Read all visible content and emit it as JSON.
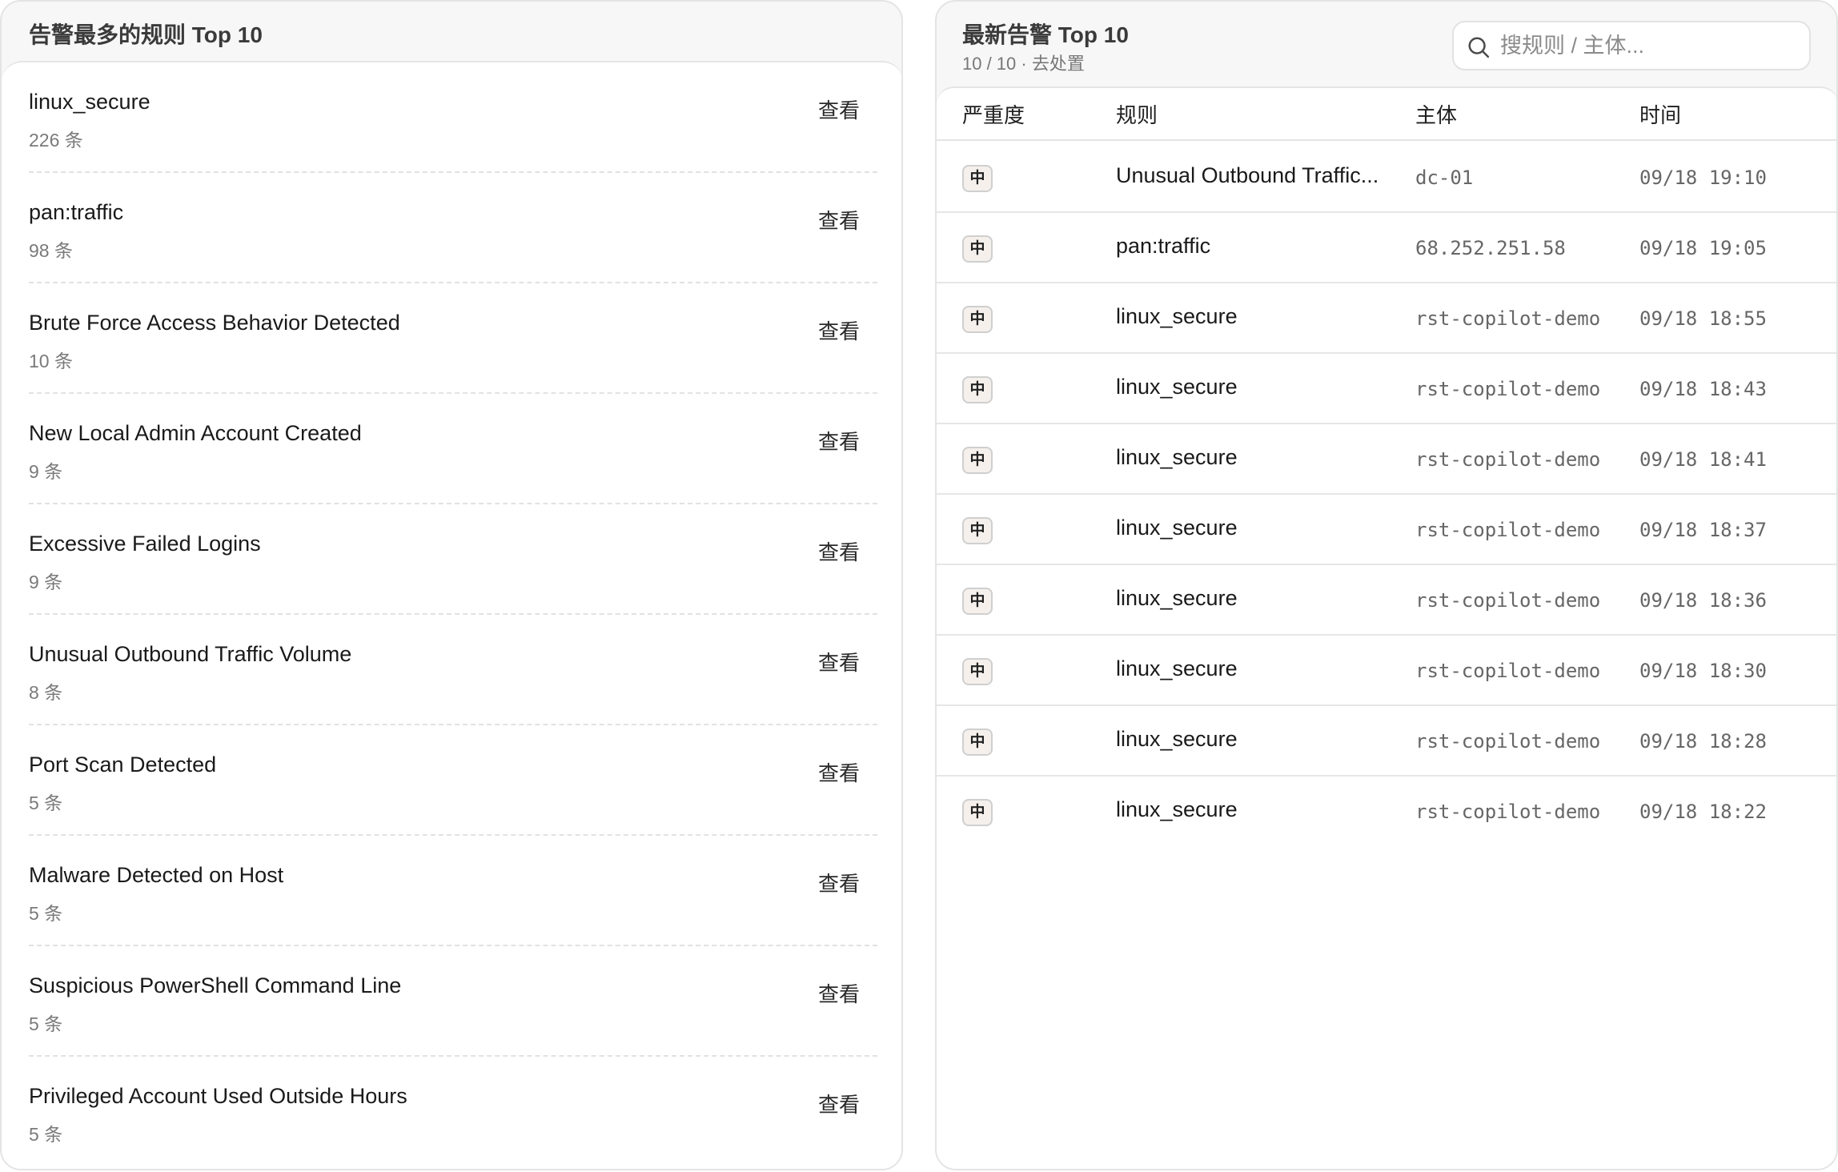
{
  "left": {
    "title": "告警最多的规则 Top 10",
    "view_label": "查看",
    "rules": [
      {
        "name": "linux_secure",
        "count": "226 条"
      },
      {
        "name": "pan:traffic",
        "count": "98 条"
      },
      {
        "name": "Brute Force Access Behavior Detected",
        "count": "10 条"
      },
      {
        "name": "New Local Admin Account Created",
        "count": "9 条"
      },
      {
        "name": "Excessive Failed Logins",
        "count": "9 条"
      },
      {
        "name": "Unusual Outbound Traffic Volume",
        "count": "8 条"
      },
      {
        "name": "Port Scan Detected",
        "count": "5 条"
      },
      {
        "name": "Malware Detected on Host",
        "count": "5 条"
      },
      {
        "name": "Suspicious PowerShell Command Line",
        "count": "5 条"
      },
      {
        "name": "Privileged Account Used Outside Hours",
        "count": "5 条"
      }
    ]
  },
  "right": {
    "title": "最新告警 Top 10",
    "subtitle": "10 / 10 · 去处置",
    "search": {
      "placeholder": "搜规则 / 主体...",
      "value": ""
    },
    "columns": {
      "severity": "严重度",
      "rule": "规则",
      "subject": "主体",
      "time": "时间"
    },
    "rows": [
      {
        "severity": "中",
        "rule": "Unusual Outbound Traffic...",
        "subject": "dc-01",
        "time": "09/18 19:10"
      },
      {
        "severity": "中",
        "rule": "pan:traffic",
        "subject": "68.252.251.58",
        "time": "09/18 19:05"
      },
      {
        "severity": "中",
        "rule": "linux_secure",
        "subject": "rst-copilot-demo",
        "time": "09/18 18:55"
      },
      {
        "severity": "中",
        "rule": "linux_secure",
        "subject": "rst-copilot-demo",
        "time": "09/18 18:43"
      },
      {
        "severity": "中",
        "rule": "linux_secure",
        "subject": "rst-copilot-demo",
        "time": "09/18 18:41"
      },
      {
        "severity": "中",
        "rule": "linux_secure",
        "subject": "rst-copilot-demo",
        "time": "09/18 18:37"
      },
      {
        "severity": "中",
        "rule": "linux_secure",
        "subject": "rst-copilot-demo",
        "time": "09/18 18:36"
      },
      {
        "severity": "中",
        "rule": "linux_secure",
        "subject": "rst-copilot-demo",
        "time": "09/18 18:30"
      },
      {
        "severity": "中",
        "rule": "linux_secure",
        "subject": "rst-copilot-demo",
        "time": "09/18 18:28"
      },
      {
        "severity": "中",
        "rule": "linux_secure",
        "subject": "rst-copilot-demo",
        "time": "09/18 18:22"
      }
    ]
  },
  "icons": {
    "search": "search-icon"
  }
}
